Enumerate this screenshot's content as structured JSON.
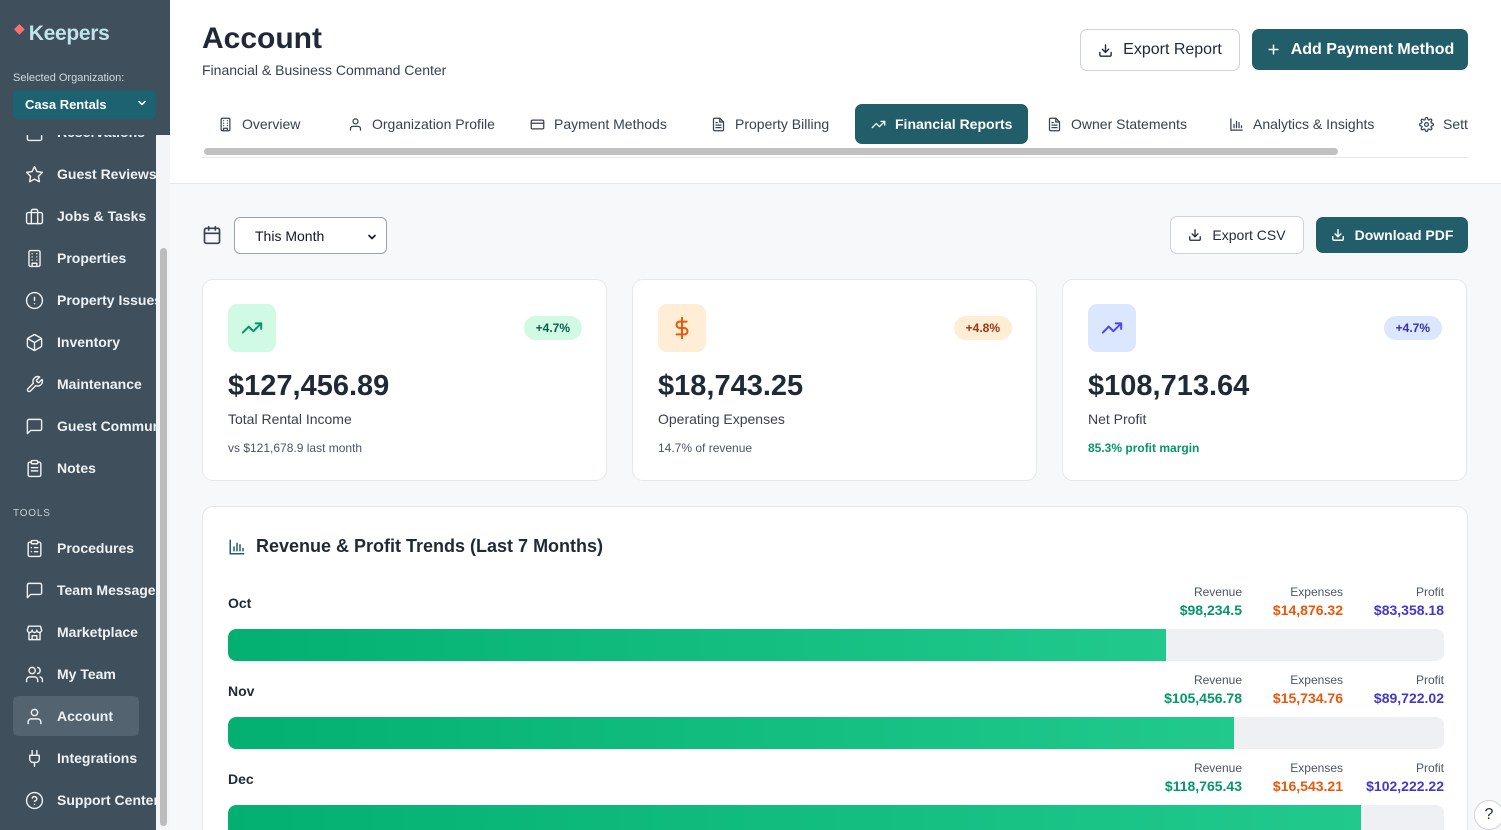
{
  "brand": {
    "name": "Keepers"
  },
  "organization": {
    "label": "Selected Organization:",
    "selected": "Casa Rentals"
  },
  "sidebar": {
    "items": [
      {
        "label": "Reservations",
        "icon": "calendar-icon"
      },
      {
        "label": "Guest Reviews",
        "icon": "star-icon"
      },
      {
        "label": "Jobs & Tasks",
        "icon": "briefcase-icon"
      },
      {
        "label": "Properties",
        "icon": "building-icon"
      },
      {
        "label": "Property Issues",
        "icon": "alert-circle-icon"
      },
      {
        "label": "Inventory",
        "icon": "package-icon"
      },
      {
        "label": "Maintenance",
        "icon": "wrench-icon"
      },
      {
        "label": "Guest Communication",
        "icon": "message-icon"
      },
      {
        "label": "Notes",
        "icon": "clipboard-icon"
      }
    ],
    "tools_label": "TOOLS",
    "tools": [
      {
        "label": "Procedures",
        "icon": "clipboard-list-icon"
      },
      {
        "label": "Team Messages",
        "icon": "message-icon"
      },
      {
        "label": "Marketplace",
        "icon": "store-icon"
      },
      {
        "label": "My Team",
        "icon": "users-icon"
      },
      {
        "label": "Account",
        "icon": "user-icon",
        "active": true
      },
      {
        "label": "Integrations",
        "icon": "plug-icon"
      },
      {
        "label": "Support Center",
        "icon": "help-circle-icon"
      }
    ]
  },
  "header": {
    "title": "Account",
    "subtitle": "Financial & Business Command Center",
    "export_report": "Export Report",
    "add_payment": "Add Payment Method"
  },
  "tabs": [
    {
      "label": "Overview",
      "icon": "building-icon"
    },
    {
      "label": "Organization Profile",
      "icon": "user-icon"
    },
    {
      "label": "Payment Methods",
      "icon": "credit-card-icon"
    },
    {
      "label": "Property Billing",
      "icon": "file-text-icon"
    },
    {
      "label": "Financial Reports",
      "icon": "trending-up-icon",
      "active": true
    },
    {
      "label": "Owner Statements",
      "icon": "file-text-icon"
    },
    {
      "label": "Analytics & Insights",
      "icon": "bar-chart-icon"
    },
    {
      "label": "Settings",
      "icon": "gear-icon"
    }
  ],
  "controls": {
    "period": "This Month",
    "export_csv": "Export CSV",
    "download_pdf": "Download PDF"
  },
  "kpis": [
    {
      "value": "$127,456.89",
      "label": "Total Rental Income",
      "change": "+4.7%",
      "note": "vs $121,678.9 last month",
      "icon": "trending-up-icon",
      "accent": "#059669",
      "icon_bg": "#d1fae5",
      "badge_bg": "#d1fae5",
      "badge_fg": "#065f46",
      "note_color": "#4b5563"
    },
    {
      "value": "$18,743.25",
      "label": "Operating Expenses",
      "change": "+4.8%",
      "note": "14.7% of revenue",
      "icon": "dollar-icon",
      "accent": "#ea580c",
      "icon_bg": "#ffedd5",
      "badge_bg": "#ffedd5",
      "badge_fg": "#9a3412",
      "note_color": "#4b5563"
    },
    {
      "value": "$108,713.64",
      "label": "Net Profit",
      "change": "+4.7%",
      "note": "85.3% profit margin",
      "icon": "trending-up-icon",
      "accent": "#4f46e5",
      "icon_bg": "#dbe7fe",
      "badge_bg": "#dbe7fe",
      "badge_fg": "#3730a3",
      "note_color": "#059669"
    }
  ],
  "trends": {
    "title": "Revenue & Profit Trends (Last 7 Months)",
    "revenue_label": "Revenue",
    "expenses_label": "Expenses",
    "profit_label": "Profit",
    "colors": {
      "revenue": "#059669",
      "expenses": "#ea580c",
      "profit": "#4338ca"
    },
    "months": [
      {
        "name": "Oct",
        "revenue": "$98,234.5",
        "expenses": "$14,876.32",
        "profit": "$83,358.18",
        "fill": 0.771
      },
      {
        "name": "Nov",
        "revenue": "$105,456.78",
        "expenses": "$15,734.76",
        "profit": "$89,722.02",
        "fill": 0.827
      },
      {
        "name": "Dec",
        "revenue": "$118,765.43",
        "expenses": "$16,543.21",
        "profit": "$102,222.22",
        "fill": 0.932
      }
    ]
  },
  "help": {
    "label": "?"
  }
}
